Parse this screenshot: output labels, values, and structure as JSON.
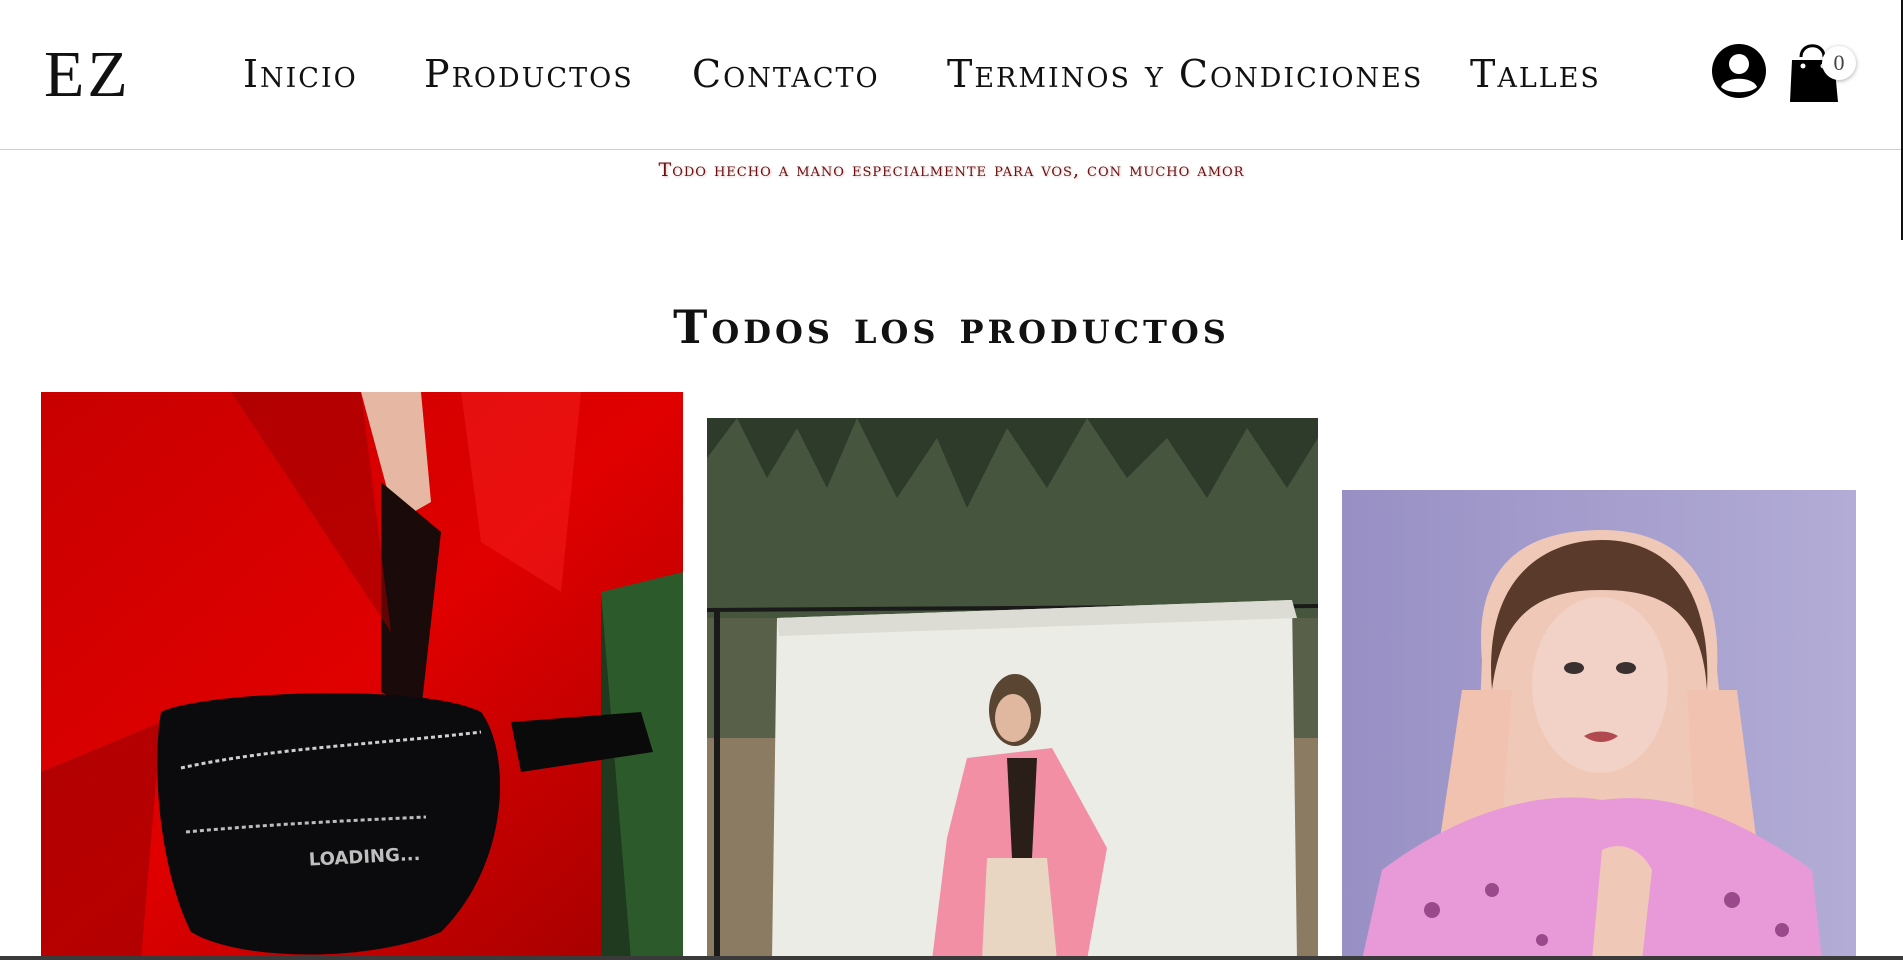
{
  "brand": {
    "logo": "EZ"
  },
  "nav": {
    "items": [
      "Inicio",
      "Productos",
      "Contacto",
      "Terminos y Condiciones",
      "Talles"
    ]
  },
  "header": {
    "user_icon": "user-circle-icon",
    "cart_icon": "shopping-bag-icon",
    "cart_count": "0"
  },
  "tagline": "Todo hecho a mano especialmente para vos, con mucho amor",
  "section": {
    "title": "Todos los productos"
  },
  "products": [
    {
      "image": "red-blazer-black-fanny-pack-photo",
      "bag_print": "LOADING..."
    },
    {
      "image": "pink-coat-white-backdrop-photo"
    },
    {
      "image": "pink-fur-jacket-portrait-photo"
    }
  ],
  "colors": {
    "tagline": "#6a1010",
    "text": "#111111",
    "divider": "#cfcfcf"
  }
}
